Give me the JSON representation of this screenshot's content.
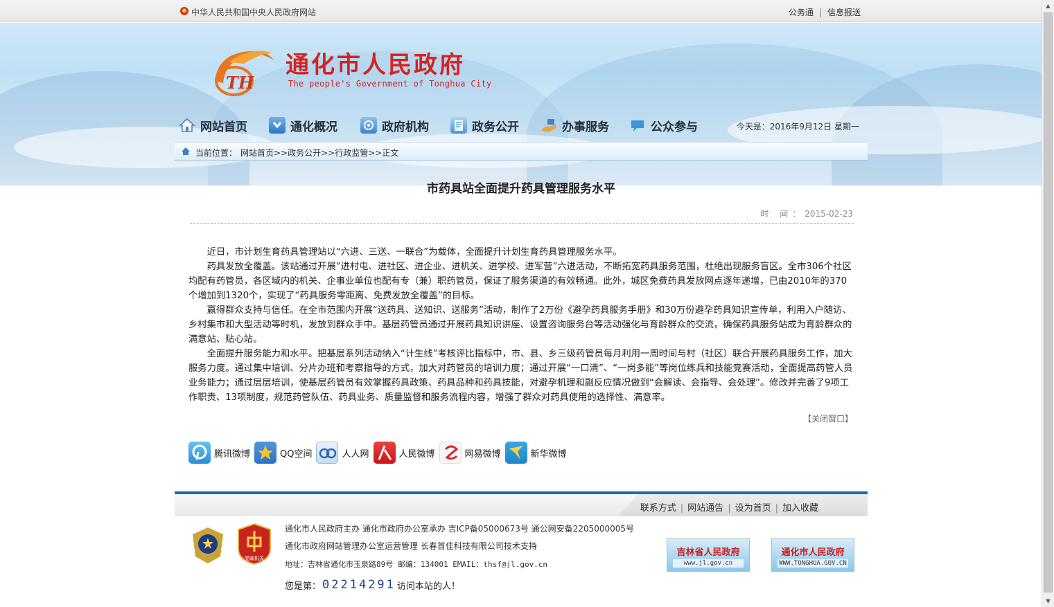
{
  "topbar": {
    "site_link": "中华人民共和国中央人民政府网站",
    "links": [
      "公务通",
      "信息报送"
    ],
    "separator": "|"
  },
  "header": {
    "title": "通化市人民政府",
    "subtitle": "The people's Government of Tonghua City",
    "logo_letters": "TH"
  },
  "nav": {
    "items": [
      {
        "label": "网站首页",
        "icon": "home-icon"
      },
      {
        "label": "通化概况",
        "icon": "overview-icon"
      },
      {
        "label": "政府机构",
        "icon": "org-icon"
      },
      {
        "label": "政务公开",
        "icon": "document-icon"
      },
      {
        "label": "办事服务",
        "icon": "service-icon"
      },
      {
        "label": "公众参与",
        "icon": "chat-bubble-icon"
      }
    ],
    "date": "今天是：2016年9月12日   星期一"
  },
  "breadcrumb": {
    "label": "当前位置：",
    "path": "网站首页>>政务公开>>行政监管>>正文"
  },
  "article": {
    "title": "市药具站全面提升药具管理服务水平",
    "time_label": "时 间：",
    "time_value": "2015-02-23",
    "paragraphs": [
      "近日，市计划生育药具管理站以“六进、三送、一联合”为载体，全面提升计划生育药具管理服务水平。",
      "药具发放全覆盖。该站通过开展“进村屯、进社区、进企业、进机关、进学校、进军营”六进活动，不断拓宽药具服务范围，杜绝出现服务盲区。全市306个社区均配有药管员，各区域内的机关、企事业单位也配有专（兼）职药管员，保证了服务渠道的有效畅通。此外，城区免费药具发放网点逐年递增，已由2010年的370个增加到1320个，实现了“药具服务零距离、免费发放全覆盖”的目标。",
      "赢得群众支持与信任。在全市范围内开展“送药具、送知识、送服务”活动，制作了2万份《避孕药具服务手册》和30万份避孕药具知识宣传单，利用入户随访、乡村集市和大型活动等时机，发放到群众手中。基层药管员通过开展药具知识讲座、设置咨询服务台等活动强化与育龄群众的交流，确保药具服务站成为育龄群众的满意站、贴心站。",
      "全面提升服务能力和水平。把基层系列活动纳入“计生线”考核评比指标中，市、县、乡三级药管员每月利用一周时间与村（社区）联合开展药具服务工作，加大服务力度。通过集中培训、分片办班和考察指导的方式，加大对药管员的培训力度；通过开展“一口清”、“一岗多能”等岗位练兵和技能竞赛活动，全面提高药管人员业务能力；通过层层培训，使基层药管员有效掌握药具政策、药具品种和药具技能，对避孕机理和副反应情况做到“会解读、会指导、会处理”。修改并完善了9项工作职责、13项制度，规范药管队伍、药具业务、质量监督和服务流程内容，增强了群众对药具使用的选择性、满意率。"
    ],
    "close_label": "【关闭窗口】"
  },
  "share": {
    "items": [
      {
        "label": "腾讯微博",
        "icon": "tencent-weibo-icon",
        "color": "#2b8ed6"
      },
      {
        "label": "QQ空间",
        "icon": "qzone-star-icon",
        "color": "#2c73c4"
      },
      {
        "label": "人人网",
        "icon": "renren-icon",
        "color": "#2a69b3"
      },
      {
        "label": "人民微博",
        "icon": "people-weibo-icon",
        "color": "#d4201b"
      },
      {
        "label": "网易微博",
        "icon": "netease-weibo-icon",
        "color": "#d02c2c"
      },
      {
        "label": "新华微博",
        "icon": "xinhua-weibo-icon",
        "color": "#1d87c8"
      }
    ]
  },
  "footer": {
    "links": [
      "联系方式",
      "网站通告",
      "设为首页",
      "加入收藏"
    ],
    "line1": "通化市人民政府主办  通化市政府办公室承办  吉ICP备05000673号  通公网安备2205000005号",
    "line2": "通化市政府网站管理办公室运营管理  长春首佳科技有限公司技术支持",
    "line3": "地址：吉林省通化市玉泉路89号  邮编：134001  EMAIL：thsf@jl.gov.cn",
    "visit_prefix": "您是第：",
    "visit_count": "02214291",
    "visit_suffix": "访问本站的人！",
    "party_emblem_text": "党政机关",
    "banners": [
      {
        "title": "吉林省人民政府",
        "url": "www.jl.gov.cn"
      },
      {
        "title": "通化市人民政府",
        "url": "WWW.TONGHUA.GOV.CN"
      }
    ]
  },
  "colors": {
    "brand_red": "#d5231f",
    "footer_blue": "#1f68b5"
  }
}
